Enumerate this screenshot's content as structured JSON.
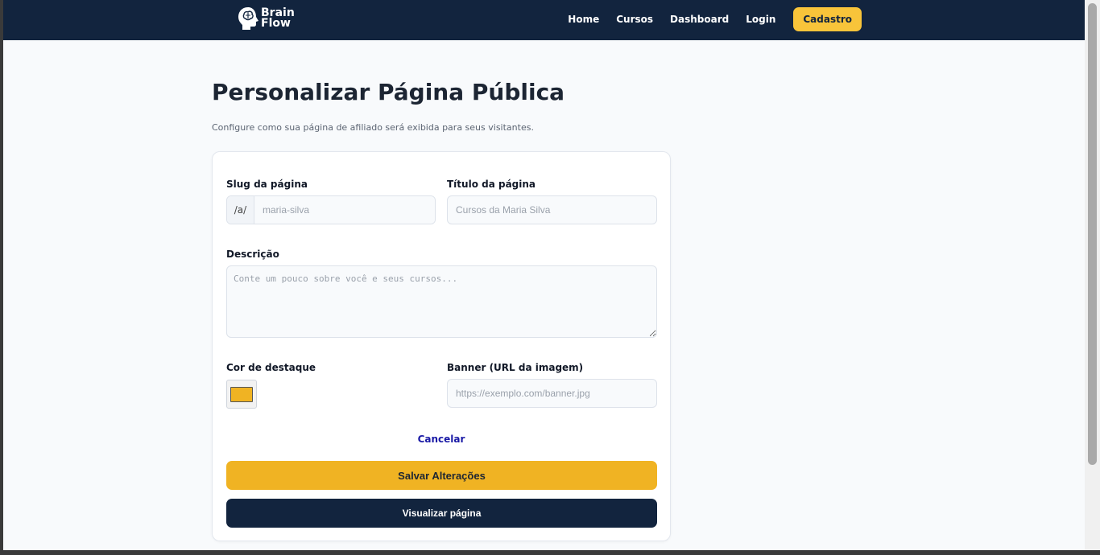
{
  "nav": {
    "logo": {
      "line1": "Brain",
      "line2": "Flow"
    },
    "links": [
      "Home",
      "Cursos",
      "Dashboard",
      "Login"
    ],
    "cta": "Cadastro"
  },
  "page": {
    "title": "Personalizar Página Pública",
    "subtitle": "Configure como sua página de afiliado será exibida para seus visitantes."
  },
  "form": {
    "slug": {
      "label": "Slug da página",
      "prefix": "/a/",
      "placeholder": "maria-silva",
      "value": ""
    },
    "title": {
      "label": "Título da página",
      "placeholder": "Cursos da Maria Silva",
      "value": ""
    },
    "description": {
      "label": "Descrição",
      "placeholder": "Conte um pouco sobre você e seus cursos...",
      "value": ""
    },
    "accent_color": {
      "label": "Cor de destaque",
      "value": "#f0b323"
    },
    "banner": {
      "label": "Banner (URL da imagem)",
      "placeholder": "https://exemplo.com/banner.jpg",
      "value": ""
    },
    "cancel": "Cancelar",
    "save": "Salvar Alterações",
    "preview": "Visualizar página"
  },
  "colors": {
    "navbar": "#12243e",
    "accent": "#f0b323",
    "cta": "#f8c43a",
    "background": "#f8fafc"
  }
}
